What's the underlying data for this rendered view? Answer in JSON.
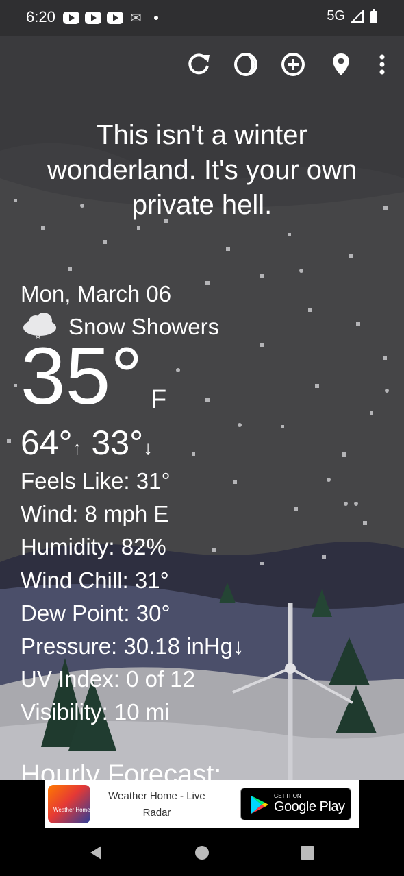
{
  "status": {
    "time": "6:20",
    "network": "5G"
  },
  "quote": "This isn't a winter wonderland. It's your own private hell.",
  "weather": {
    "date": "Mon, March 06",
    "condition": "Snow Showers",
    "temp": "35°",
    "unit": "F",
    "high": "64°",
    "low": "33°",
    "details": [
      "Feels Like:  31°",
      "Wind:  8 mph E",
      "Humidity:  82%",
      "Wind Chill:  31°",
      "Dew Point:  30°",
      "Pressure:  30.18 inHg↓",
      "UV Index:  0 of 12",
      "Visibility:  10 mi"
    ]
  },
  "hourly_title": "Hourly Forecast:",
  "ad": {
    "app_icon_text": "Weather Home",
    "title": "Weather Home - Live Radar",
    "store_small": "GET IT ON",
    "store_big": "Google Play"
  },
  "icons": {
    "toolbar": [
      "refresh-icon",
      "theme-icon",
      "add-location-icon",
      "location-pin-icon",
      "more-vert-icon"
    ],
    "nav": [
      "back-icon",
      "home-icon",
      "recents-icon"
    ]
  }
}
